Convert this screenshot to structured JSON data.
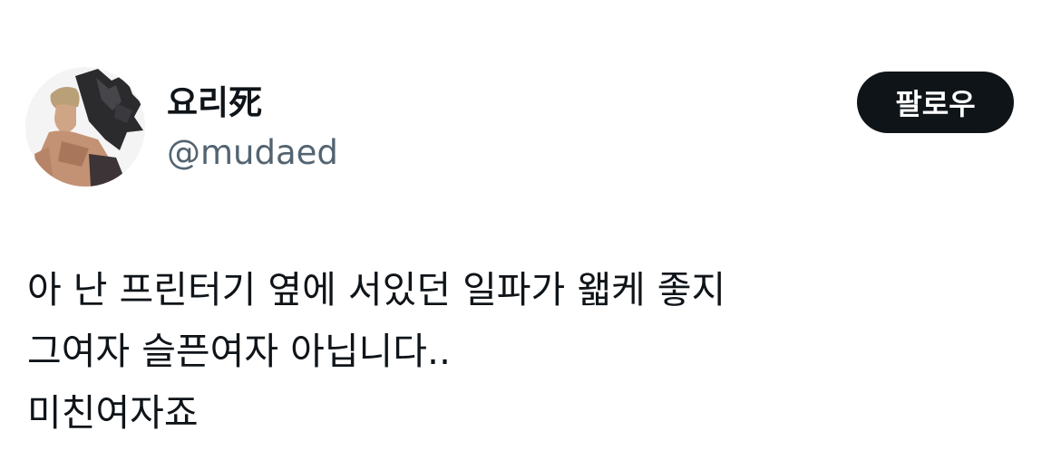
{
  "user": {
    "display_name": "요리死",
    "handle": "@mudaed"
  },
  "follow_button": {
    "label": "팔로우"
  },
  "tweet": {
    "lines": [
      "아 난 프린터기 옆에 서있던 일파가 왧케 좋지",
      "그여자 슬픈여자 아닙니다..",
      "미친여자죠"
    ]
  },
  "colors": {
    "text_primary": "#0f1419",
    "text_secondary": "#536471",
    "button_bg": "#0f1419",
    "button_text": "#ffffff",
    "background": "#ffffff"
  }
}
